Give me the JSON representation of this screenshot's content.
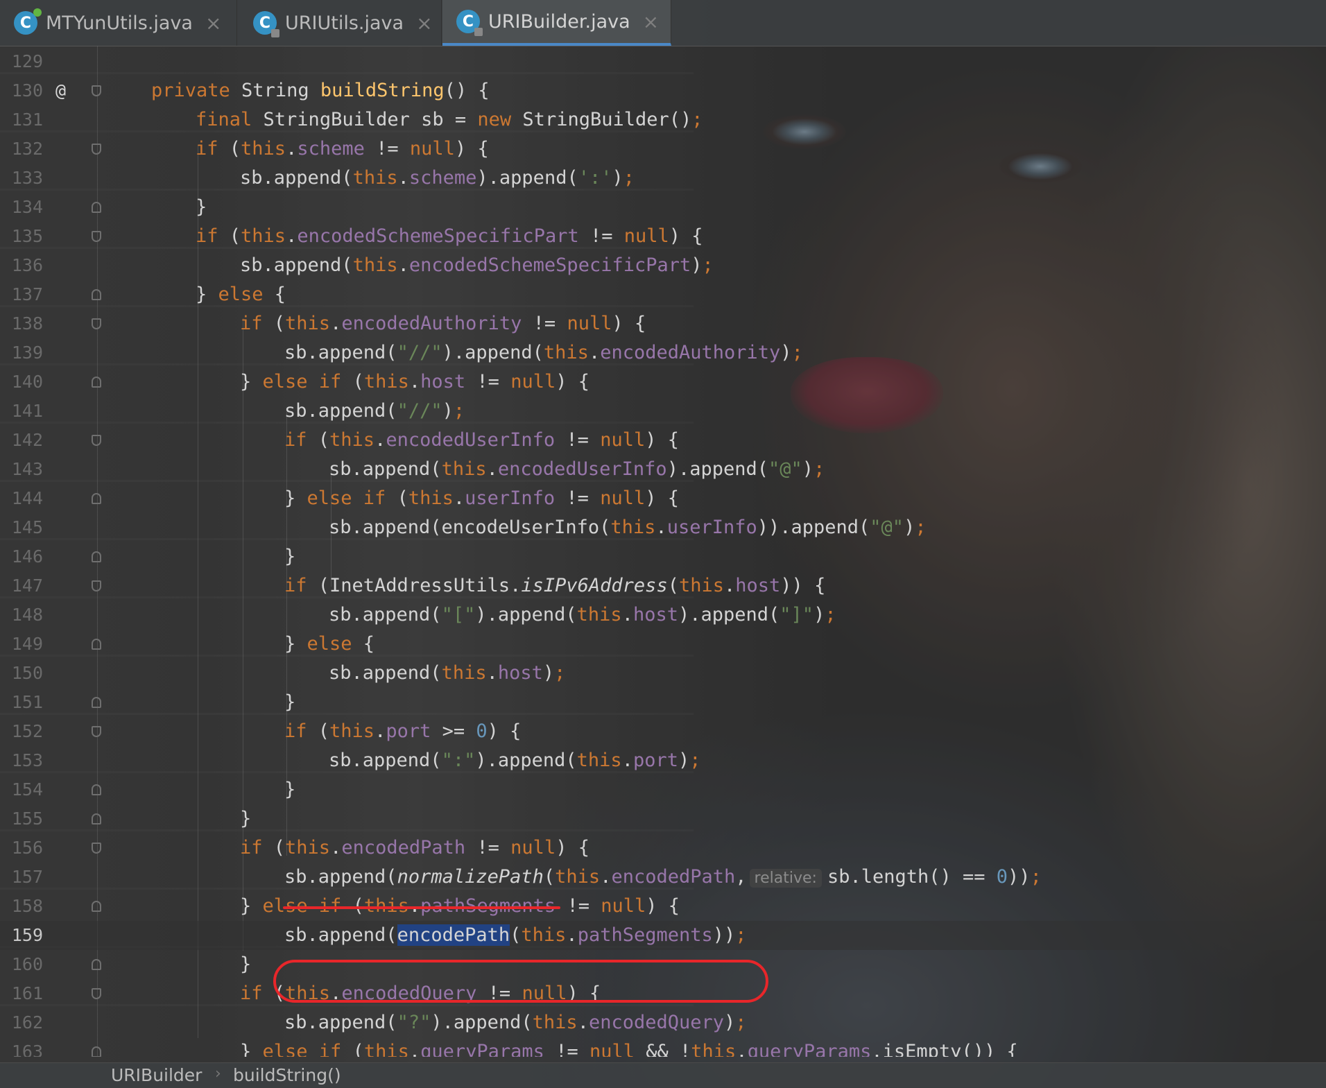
{
  "tabs": [
    {
      "label": "MTYunUtils.java",
      "active": false,
      "icon": "java-class-icon"
    },
    {
      "label": "URIUtils.java",
      "active": false,
      "icon": "java-class-icon"
    },
    {
      "label": "URIBuilder.java",
      "active": true,
      "icon": "java-class-icon"
    }
  ],
  "tab_close_glyph": "×",
  "gutter": {
    "override_marker": "@"
  },
  "lines": [
    {
      "num": "129"
    },
    {
      "num": "130"
    },
    {
      "num": "131"
    },
    {
      "num": "132"
    },
    {
      "num": "133"
    },
    {
      "num": "134"
    },
    {
      "num": "135"
    },
    {
      "num": "136"
    },
    {
      "num": "137"
    },
    {
      "num": "138"
    },
    {
      "num": "139"
    },
    {
      "num": "140"
    },
    {
      "num": "141"
    },
    {
      "num": "142"
    },
    {
      "num": "143"
    },
    {
      "num": "144"
    },
    {
      "num": "145"
    },
    {
      "num": "146"
    },
    {
      "num": "147"
    },
    {
      "num": "148"
    },
    {
      "num": "149"
    },
    {
      "num": "150"
    },
    {
      "num": "151"
    },
    {
      "num": "152"
    },
    {
      "num": "153"
    },
    {
      "num": "154"
    },
    {
      "num": "155"
    },
    {
      "num": "156"
    },
    {
      "num": "157"
    },
    {
      "num": "158"
    },
    {
      "num": "159"
    },
    {
      "num": "160"
    },
    {
      "num": "161"
    },
    {
      "num": "162"
    },
    {
      "num": "163"
    }
  ],
  "current_line": "159",
  "parameter_hint": "relative:",
  "breadcrumb": [
    "URIBuilder",
    "buildString()"
  ],
  "colors": {
    "keyword": "#cc7832",
    "field": "#9876aa",
    "string": "#6a8759",
    "number": "#6897bb",
    "method_decl": "#ffc66d",
    "annotation_red": "#e8262a",
    "selection": "#214283",
    "tab_underline": "#4a88c7"
  }
}
